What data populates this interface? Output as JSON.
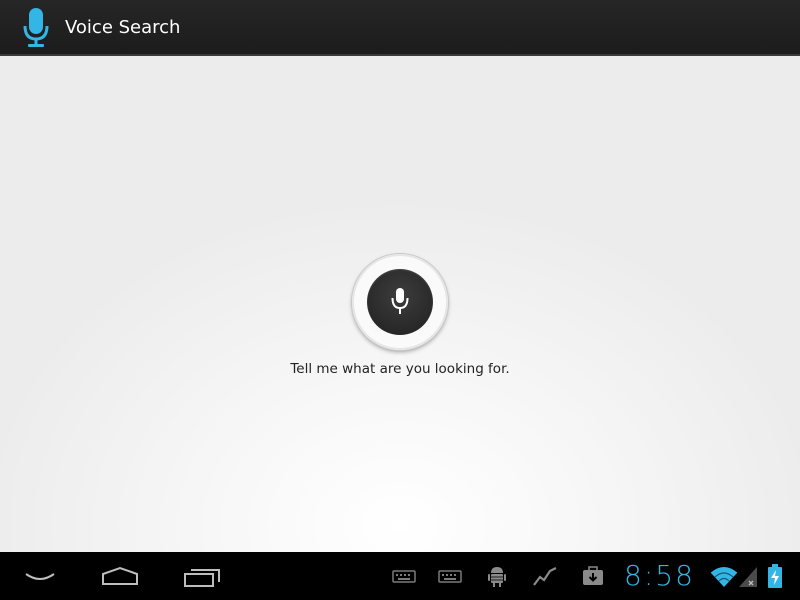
{
  "action_bar": {
    "title": "Voice Search",
    "icon": "microphone-icon"
  },
  "voice_prompt": {
    "message": "Tell me what are you looking for.",
    "button_icon": "microphone-icon"
  },
  "system_bar": {
    "nav": [
      "back-icon",
      "home-icon",
      "recent-apps-icon"
    ],
    "notifications": [
      "keyboard-icon",
      "keyboard-icon",
      "android-debug-icon",
      "activity-graph-icon",
      "download-icon"
    ],
    "clock": "8:58",
    "status_icons": [
      "wifi-icon",
      "cellular-signal-icon",
      "battery-charging-icon"
    ]
  },
  "colors": {
    "accent": "#33b5e5",
    "action_bar": "#1f1f1f",
    "mic_button": "#2a2a2a",
    "text": "#222222"
  }
}
